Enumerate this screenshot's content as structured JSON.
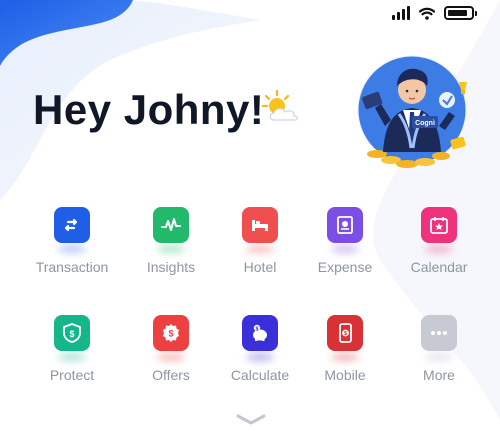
{
  "greeting": {
    "text": "Hey Johny!",
    "icon": "sun-behind-cloud-icon"
  },
  "hero": {
    "badge_text": "Cognì"
  },
  "status": {
    "signal_bars": 4,
    "wifi": true,
    "battery_level": 0.85
  },
  "menu": [
    {
      "label": "Transaction",
      "icon": "transaction-icon",
      "color": "#1f5fe8",
      "shadow": "#2f6cf0"
    },
    {
      "label": "Insights",
      "icon": "insights-icon",
      "color": "#22b96a",
      "shadow": "#22b96a"
    },
    {
      "label": "Hotel",
      "icon": "hotel-icon",
      "color": "#ef4f4f",
      "shadow": "#ef4f4f"
    },
    {
      "label": "Expense",
      "icon": "expense-icon",
      "color": "#7d4ee6",
      "shadow": "#7d4ee6"
    },
    {
      "label": "Calendar",
      "icon": "calendar-icon",
      "color": "#f0317b",
      "shadow": "#f0317b"
    },
    {
      "label": "Protect",
      "icon": "shield-icon",
      "color": "#14b68a",
      "shadow": "#14b68a"
    },
    {
      "label": "Offers",
      "icon": "offers-icon",
      "color": "#ee4040",
      "shadow": "#ee4040"
    },
    {
      "label": "Calculate",
      "icon": "piggy-bank-icon",
      "color": "#3a2fd8",
      "shadow": "#3a2fd8"
    },
    {
      "label": "Mobile",
      "icon": "mobile-icon",
      "color": "#d83236",
      "shadow": "#d83236"
    },
    {
      "label": "More",
      "icon": "more-icon",
      "color": "#c7c9d3",
      "shadow": "#b5b8c4"
    }
  ],
  "scroll_hint_icon": "chevron-down-icon"
}
